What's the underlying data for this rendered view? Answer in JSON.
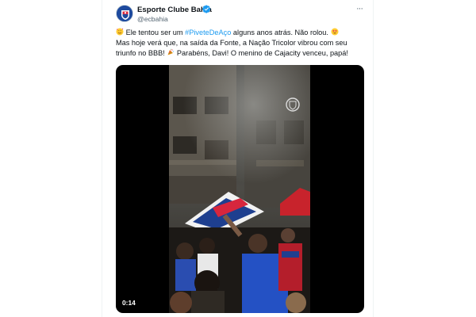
{
  "author": {
    "name": "Esporte Clube Bahia",
    "handle": "@ecbahia"
  },
  "icons": {
    "avatar": "club-crest-icon",
    "verified": "verified-badge-icon",
    "more": "more-options-icon",
    "emoji_1": "smiling-face-with-hearts-emoji",
    "emoji_2": "star-struck-emoji",
    "emoji_3": "party-popper-emoji"
  },
  "tweet": {
    "line1_pre": "Ele tentou ser um ",
    "hashtag": "#PiveteDeAço",
    "line1_post": " alguns anos atrás. Não rolou.",
    "line2": "Mas hoje verá que, na saída da Fonte, a Nação Tricolor vibrou com seu",
    "line3_pre": "triunfo no BBB!",
    "line3_post": " Parabéns, Davi! O menino de Cajacity venceu, papá!"
  },
  "media": {
    "duration": "0:14"
  },
  "colors": {
    "link": "#1d9bf0",
    "verified": "#1d9bf0",
    "secondary_text": "#536471",
    "club_blue": "#1e4a9e",
    "club_red": "#d7263d"
  }
}
